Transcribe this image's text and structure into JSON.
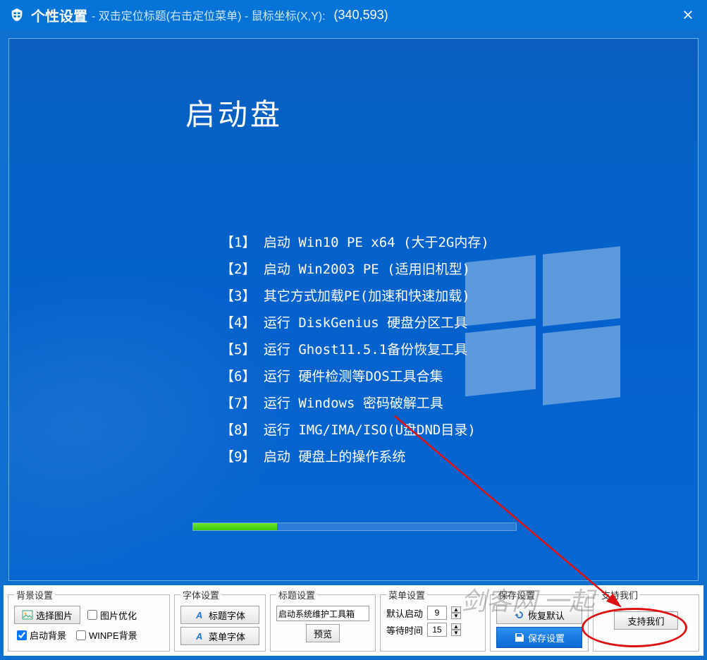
{
  "titlebar": {
    "title": "个性设置",
    "subtitle": "- 双击定位标题(右击定位菜单) - 鼠标坐标(X,Y):",
    "coords": "(340,593)"
  },
  "preview": {
    "boot_title": "启动盘",
    "menu": [
      "【1】 启动 Win10 PE x64 (大于2G内存)",
      "【2】 启动 Win2003 PE (适用旧机型)",
      "【3】 其它方式加载PE(加速和快速加载)",
      "【4】 运行 DiskGenius 硬盘分区工具",
      "【5】 运行 Ghost11.5.1备份恢复工具",
      "【6】 运行 硬件检测等DOS工具合集",
      "【7】 运行 Windows 密码破解工具",
      "【8】 运行 IMG/IMA/ISO(U盘DND目录)",
      "【9】 启动 硬盘上的操作系统"
    ]
  },
  "panels": {
    "bg": {
      "legend": "背景设置",
      "choose_image": "选择图片",
      "optimize": "图片优化",
      "boot_bg": "启动背景",
      "winpe_bg": "WINPE背景"
    },
    "font": {
      "legend": "字体设置",
      "title_font": "标题字体",
      "menu_font": "菜单字体"
    },
    "title": {
      "legend": "标题设置",
      "value": "启动系统维护工具箱",
      "preview": "预览"
    },
    "menu": {
      "legend": "菜单设置",
      "default_boot": "默认启动",
      "default_boot_value": "9",
      "wait_time": "等待时间",
      "wait_time_value": "15"
    },
    "save": {
      "legend": "保存设置",
      "restore": "恢复默认",
      "save": "保存设置"
    },
    "support": {
      "legend": "支持我们",
      "button": "支持我们"
    }
  },
  "watermark": "剑客网 一起"
}
